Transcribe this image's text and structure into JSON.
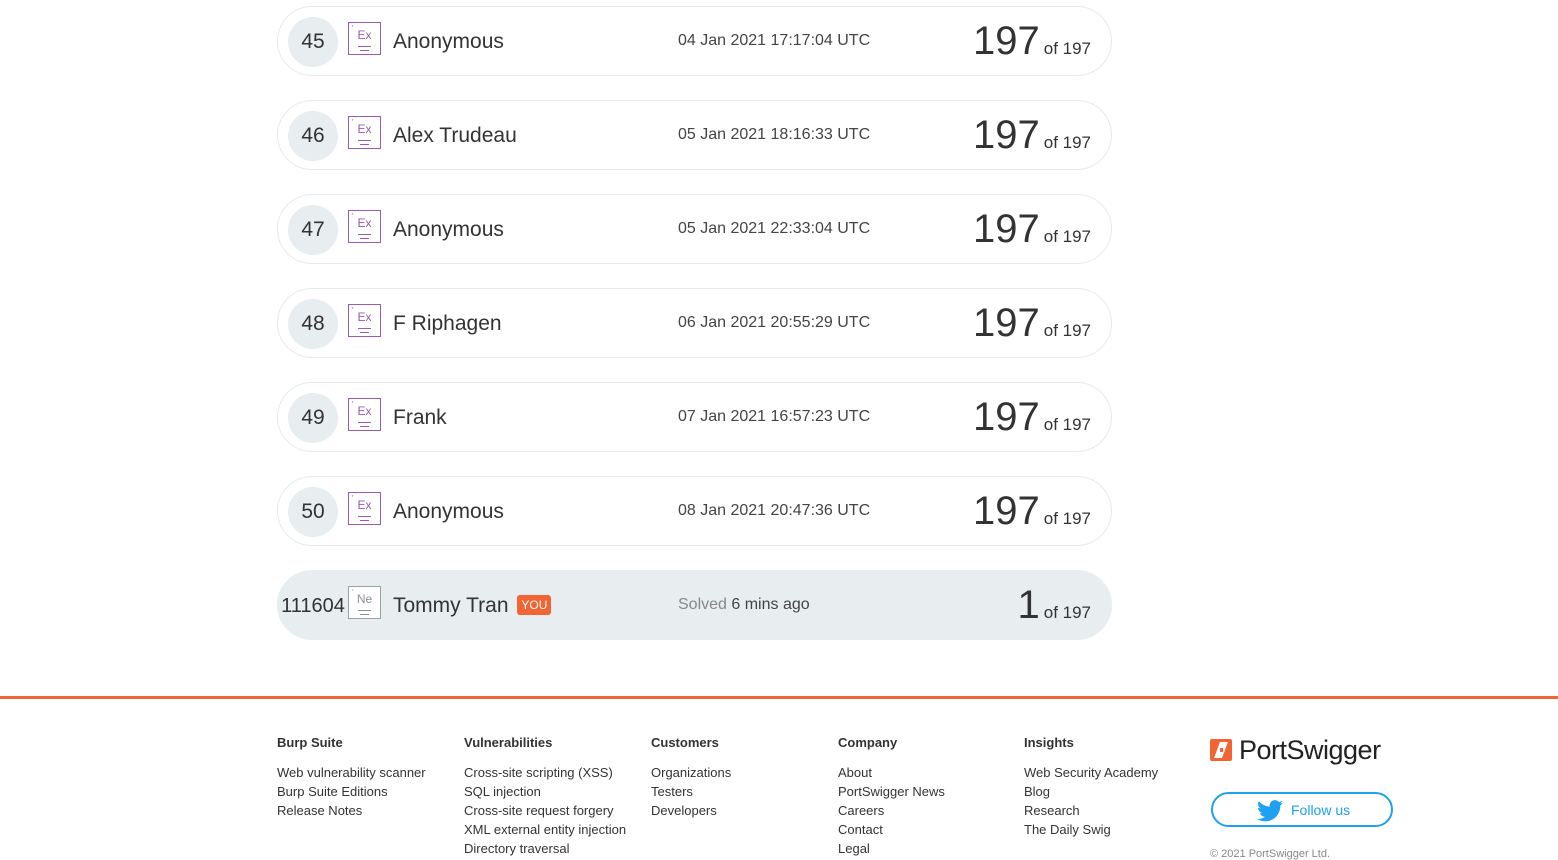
{
  "leaderboard": {
    "rows": [
      {
        "rank": "45",
        "badge": "Ex",
        "name": "Anonymous",
        "date": "04 Jan 2021 17:17:04 UTC",
        "score": "197",
        "of": "of 197"
      },
      {
        "rank": "46",
        "badge": "Ex",
        "name": "Alex Trudeau",
        "date": "05 Jan 2021 18:16:33 UTC",
        "score": "197",
        "of": "of 197"
      },
      {
        "rank": "47",
        "badge": "Ex",
        "name": "Anonymous",
        "date": "05 Jan 2021 22:33:04 UTC",
        "score": "197",
        "of": "of 197"
      },
      {
        "rank": "48",
        "badge": "Ex",
        "name": "F Riphagen",
        "date": "06 Jan 2021 20:55:29 UTC",
        "score": "197",
        "of": "of 197"
      },
      {
        "rank": "49",
        "badge": "Ex",
        "name": "Frank",
        "date": "07 Jan 2021 16:57:23 UTC",
        "score": "197",
        "of": "of 197"
      },
      {
        "rank": "50",
        "badge": "Ex",
        "name": "Anonymous",
        "date": "08 Jan 2021 20:47:36 UTC",
        "score": "197",
        "of": "of 197"
      }
    ],
    "current_user": {
      "rank": "111604",
      "badge": "Ne",
      "name": "Tommy Tran",
      "you_label": "YOU",
      "solved_label": "Solved",
      "solved_time": "6 mins ago",
      "score": "1",
      "of": "of 197"
    }
  },
  "footer": {
    "columns": [
      {
        "heading": "Burp Suite",
        "links": [
          "Web vulnerability scanner",
          "Burp Suite Editions",
          "Release Notes"
        ]
      },
      {
        "heading": "Vulnerabilities",
        "links": [
          "Cross-site scripting (XSS)",
          "SQL injection",
          "Cross-site request forgery",
          "XML external entity injection",
          "Directory traversal"
        ]
      },
      {
        "heading": "Customers",
        "links": [
          "Organizations",
          "Testers",
          "Developers"
        ]
      },
      {
        "heading": "Company",
        "links": [
          "About",
          "PortSwigger News",
          "Careers",
          "Contact",
          "Legal"
        ]
      },
      {
        "heading": "Insights",
        "links": [
          "Web Security Academy",
          "Blog",
          "Research",
          "The Daily Swig"
        ]
      }
    ],
    "logo_text": "PortSwigger",
    "follow_label": "Follow us",
    "copyright": "© 2021 PortSwigger Ltd."
  },
  "colors": {
    "accent": "#f26433",
    "twitter": "#1da1f2",
    "badge_expert": "#9b59b6"
  },
  "icons": [
    "portswigger-logo-icon",
    "twitter-bird-icon",
    "element-badge-icon"
  ]
}
